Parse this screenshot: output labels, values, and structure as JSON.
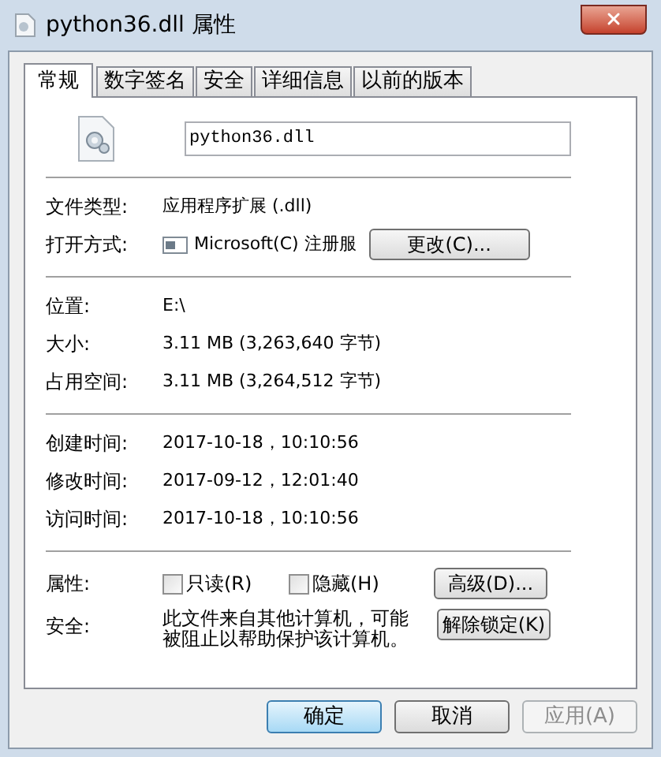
{
  "window": {
    "title": "python36.dll 属性"
  },
  "tabs": [
    {
      "label": "常规",
      "selected": true
    },
    {
      "label": "数字签名",
      "selected": false
    },
    {
      "label": "安全",
      "selected": false
    },
    {
      "label": "详细信息",
      "selected": false
    },
    {
      "label": "以前的版本",
      "selected": false
    }
  ],
  "file_name": "python36.dll",
  "groups": [
    {
      "rows": [
        {
          "kind": "text",
          "label": "文件类型:",
          "value": "应用程序扩展 (.dll)"
        },
        {
          "kind": "app",
          "label": "打开方式:",
          "value": "Microsoft(C) 注册服",
          "button": "更改(C)..."
        }
      ]
    },
    {
      "rows": [
        {
          "kind": "text",
          "label": "位置:",
          "value": "E:\\"
        },
        {
          "kind": "text",
          "label": "大小:",
          "value": "3.11 MB (3,263,640 字节)"
        },
        {
          "kind": "text",
          "label": "占用空间:",
          "value": "3.11 MB (3,264,512 字节)"
        }
      ]
    },
    {
      "rows": [
        {
          "kind": "text",
          "label": "创建时间:",
          "value": "2017-10-18，10:10:56"
        },
        {
          "kind": "text",
          "label": "修改时间:",
          "value": "2017-09-12，12:01:40"
        },
        {
          "kind": "text",
          "label": "访问时间:",
          "value": "2017-10-18，10:10:56"
        }
      ]
    }
  ],
  "attributes": {
    "label": "属性:",
    "checkboxes": [
      {
        "label": "只读(R)",
        "checked": false
      },
      {
        "label": "隐藏(H)",
        "checked": false
      }
    ],
    "button": "高级(D)..."
  },
  "security": {
    "label": "安全:",
    "text": "此文件来自其他计算机，可能被阻止以帮助保护该计算机。",
    "button": "解除锁定(K)"
  },
  "buttons": [
    {
      "label": "确定",
      "default": true,
      "disabled": false
    },
    {
      "label": "取消",
      "default": false,
      "disabled": false
    },
    {
      "label": "应用(A)",
      "default": false,
      "disabled": true
    }
  ]
}
